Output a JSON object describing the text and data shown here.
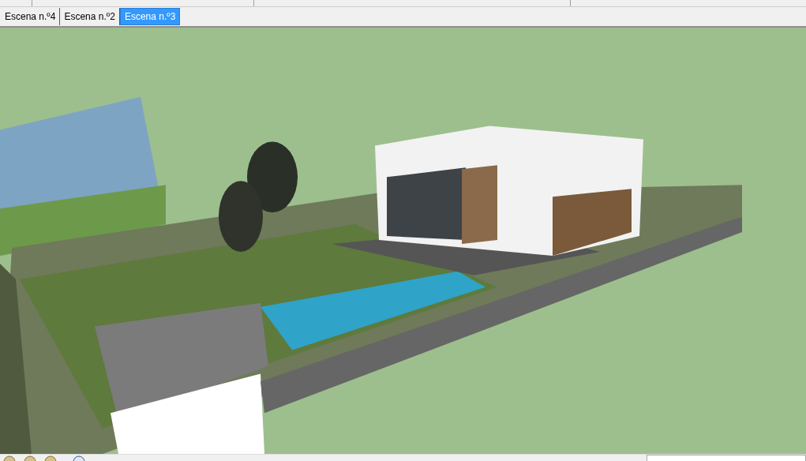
{
  "scene_tabs": [
    {
      "label": "Escena n.º4",
      "selected": false
    },
    {
      "label": "Escena n.º2",
      "selected": false
    },
    {
      "label": "Escena n.º3",
      "selected": true
    }
  ]
}
